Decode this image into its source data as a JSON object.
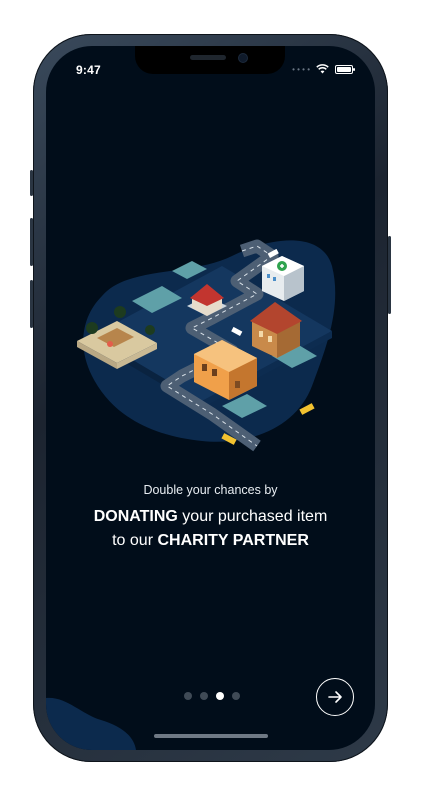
{
  "status_bar": {
    "time": "9:47"
  },
  "onboarding": {
    "subtitle": "Double your chances by",
    "highlight_1": "DONATING",
    "text_1": " your purchased item",
    "text_2": "to our ",
    "highlight_2": "CHARITY PARTNER"
  },
  "pager": {
    "count": 4,
    "active_index": 2
  },
  "icons": {
    "next": "arrow-right-icon",
    "wifi": "wifi-icon",
    "battery": "battery-icon",
    "signal": "signal-dots-icon"
  },
  "colors": {
    "background": "#010d1a",
    "accent_blob": "#0c2a4d",
    "text": "#ffffff"
  }
}
